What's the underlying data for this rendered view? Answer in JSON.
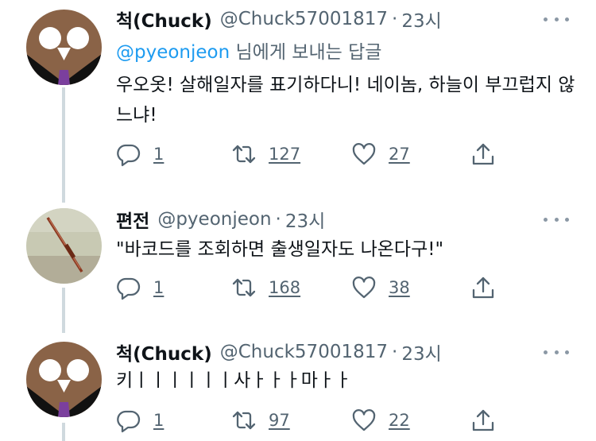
{
  "colors": {
    "link": "#1d9bf0",
    "secondary_text": "#536471",
    "thread_line": "#cfd9de"
  },
  "tweets": [
    {
      "name": "척(Chuck)",
      "handle": "@Chuck57001817",
      "dot": "·",
      "time": "23시",
      "reply_to_handle": "@pyeonjeon",
      "reply_to_suffix": " 님에게 보내는 답글",
      "text": "우오옷! 살해일자를 표기하다니! 네이놈, 하늘이 부끄럽지 않느냐!",
      "replies": "1",
      "retweets": "127",
      "likes": "27",
      "avatar_icon": "owl-avatar-icon"
    },
    {
      "name": "편전",
      "handle": "@pyeonjeon",
      "dot": "·",
      "time": "23시",
      "text": "\"바코드를 조회하면 출생일자도 나온다구!\"",
      "replies": "1",
      "retweets": "168",
      "likes": "38",
      "avatar_icon": "arrow-photo-avatar-icon"
    },
    {
      "name": "척(Chuck)",
      "handle": "@Chuck57001817",
      "dot": "·",
      "time": "23시",
      "text": "키ㅣㅣㅣㅣㅣㅣ사ㅏㅏㅏ마ㅏㅏ",
      "replies": "1",
      "retweets": "97",
      "likes": "22",
      "avatar_icon": "owl-avatar-icon"
    }
  ]
}
